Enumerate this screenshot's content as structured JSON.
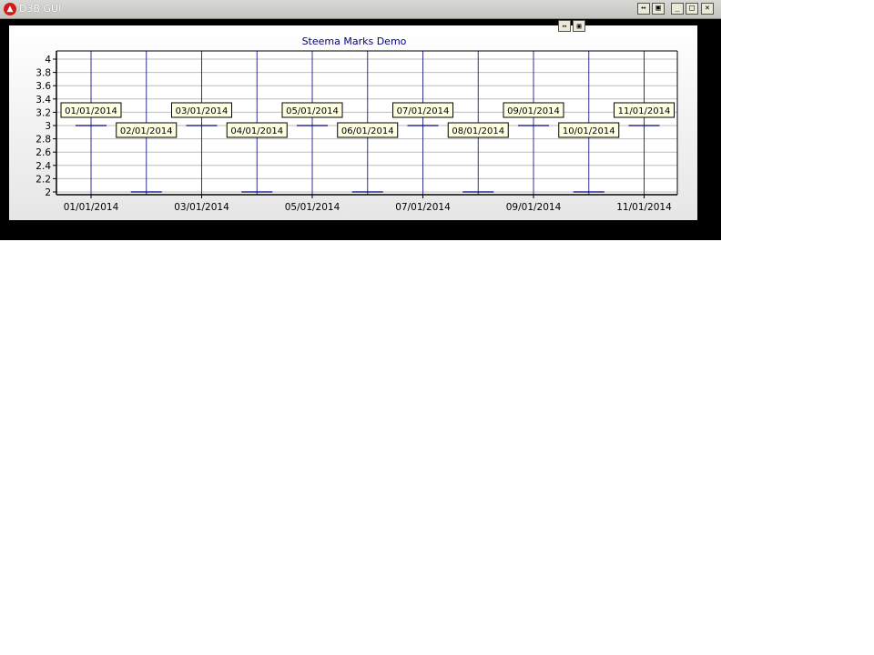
{
  "window": {
    "title": "D3B GUI",
    "app_icon": "app-logo-icon",
    "buttons": [
      "pin-icon",
      "restore-icon",
      "minimize-icon",
      "maximize-icon",
      "close-icon"
    ]
  },
  "chart_data": {
    "type": "line",
    "title": "Steema Marks Demo",
    "xlabel": "",
    "ylabel": "",
    "ylim": [
      2,
      4
    ],
    "y_ticks": [
      "4",
      "3.8",
      "3.6",
      "3.4",
      "3.2",
      "3",
      "2.8",
      "2.6",
      "2.4",
      "2.2",
      "2"
    ],
    "x_tick_labels": [
      "01/01/2014",
      "03/01/2014",
      "05/01/2014",
      "07/01/2014",
      "09/01/2014",
      "11/01/2014"
    ],
    "series": [
      {
        "x": [
          "01/01/2014",
          "02/01/2014",
          "03/01/2014",
          "04/01/2014",
          "05/01/2014",
          "06/01/2014",
          "07/01/2014",
          "08/01/2014",
          "09/01/2014",
          "10/01/2014",
          "11/01/2014"
        ],
        "values": [
          3,
          2,
          3,
          2,
          3,
          2,
          3,
          2,
          3,
          2,
          3
        ],
        "marks": [
          "01/01/2014",
          "02/01/2014",
          "03/01/2014",
          "04/01/2014",
          "05/01/2014",
          "06/01/2014",
          "07/01/2014",
          "08/01/2014",
          "09/01/2014",
          "10/01/2014",
          "11/01/2014"
        ],
        "color": "#000080"
      }
    ],
    "grid": true,
    "legend": "none"
  }
}
